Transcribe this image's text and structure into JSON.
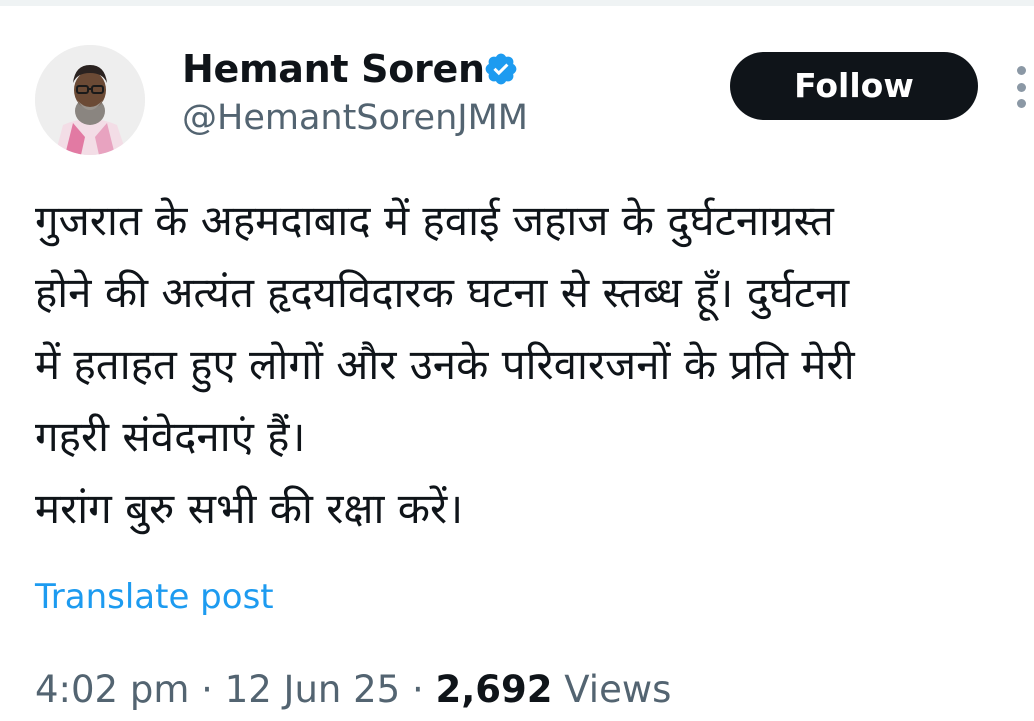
{
  "author": {
    "display_name": "Hemant Soren",
    "handle": "@HemantSorenJMM",
    "verified_icon": "verified-badge-icon"
  },
  "follow_label": "Follow",
  "more_icon": "more-options-icon",
  "tweet": {
    "lines": [
      "गुजरात के अहमदाबाद में हवाई जहाज के दुर्घटनाग्रस्त",
      "होने की अत्यंत हृदयविदारक घटना से स्तब्ध हूँ। दुर्घटना",
      "में हताहत हुए लोगों और उनके परिवारजनों के प्रति मेरी",
      "गहरी संवेदनाएं हैं।",
      "मरांग बुरु सभी की रक्षा करें।"
    ],
    "translate_label": "Translate post"
  },
  "meta": {
    "time": "4:02 pm",
    "separator": " · ",
    "date": "12 Jun 25",
    "views_count": "2,692",
    "views_label": "Views"
  },
  "colors": {
    "text": "#0f1419",
    "secondary": "#536471",
    "link": "#1d9bf0",
    "button_bg": "#0f1419",
    "badge": "#1d9bf0"
  }
}
